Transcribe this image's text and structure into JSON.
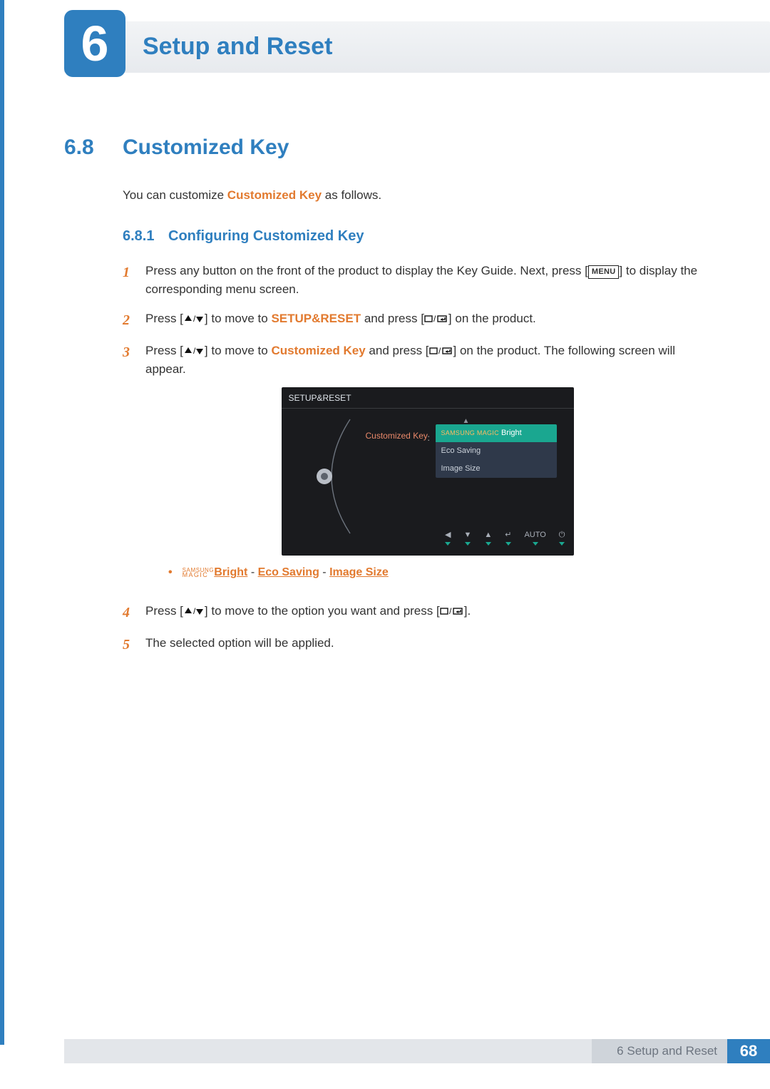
{
  "chapter": {
    "number": "6",
    "title": "Setup and Reset"
  },
  "section": {
    "number": "6.8",
    "title": "Customized Key"
  },
  "intro": {
    "pre": "You can customize ",
    "hl": "Customized Key",
    "post": " as follows."
  },
  "subsection": {
    "number": "6.8.1",
    "title": "Configuring Customized Key"
  },
  "steps": {
    "s1": {
      "a": "Press any button on the front of the product to display the Key Guide. Next, press [",
      "menu": "MENU",
      "b": "] to display the corresponding menu screen."
    },
    "s2": {
      "a": "Press [",
      "b": "] to move to ",
      "hl": "SETUP&RESET",
      "c": " and press [",
      "d": "] on the product."
    },
    "s3": {
      "a": "Press [",
      "b": "] to move to ",
      "hl": "Customized Key",
      "c": " and press [",
      "d": "] on the product. The following screen will appear."
    },
    "bullet": {
      "magic_top": "SAMSUNG",
      "magic_bottom": "MAGIC",
      "bright": "Bright",
      "sep": " - ",
      "eco": "Eco Saving",
      "img": "Image Size"
    },
    "s4": {
      "a": "Press [",
      "b": "] to move to the option you want and press [",
      "c": "]."
    },
    "s5": "The selected option will be applied."
  },
  "osd": {
    "header": "SETUP&RESET",
    "row_label": "Customized Key",
    "options": {
      "opt1_small": "SAMSUNG MAGIC",
      "opt1": "Bright",
      "opt2": "Eco Saving",
      "opt3": "Image Size"
    },
    "bottom": {
      "b1": "◀",
      "b2": "▼",
      "b3": "▲",
      "b4": "↵",
      "b5": "AUTO",
      "b6": "⏻"
    }
  },
  "footer": {
    "chapter_label": "6 Setup and Reset",
    "page": "68"
  }
}
